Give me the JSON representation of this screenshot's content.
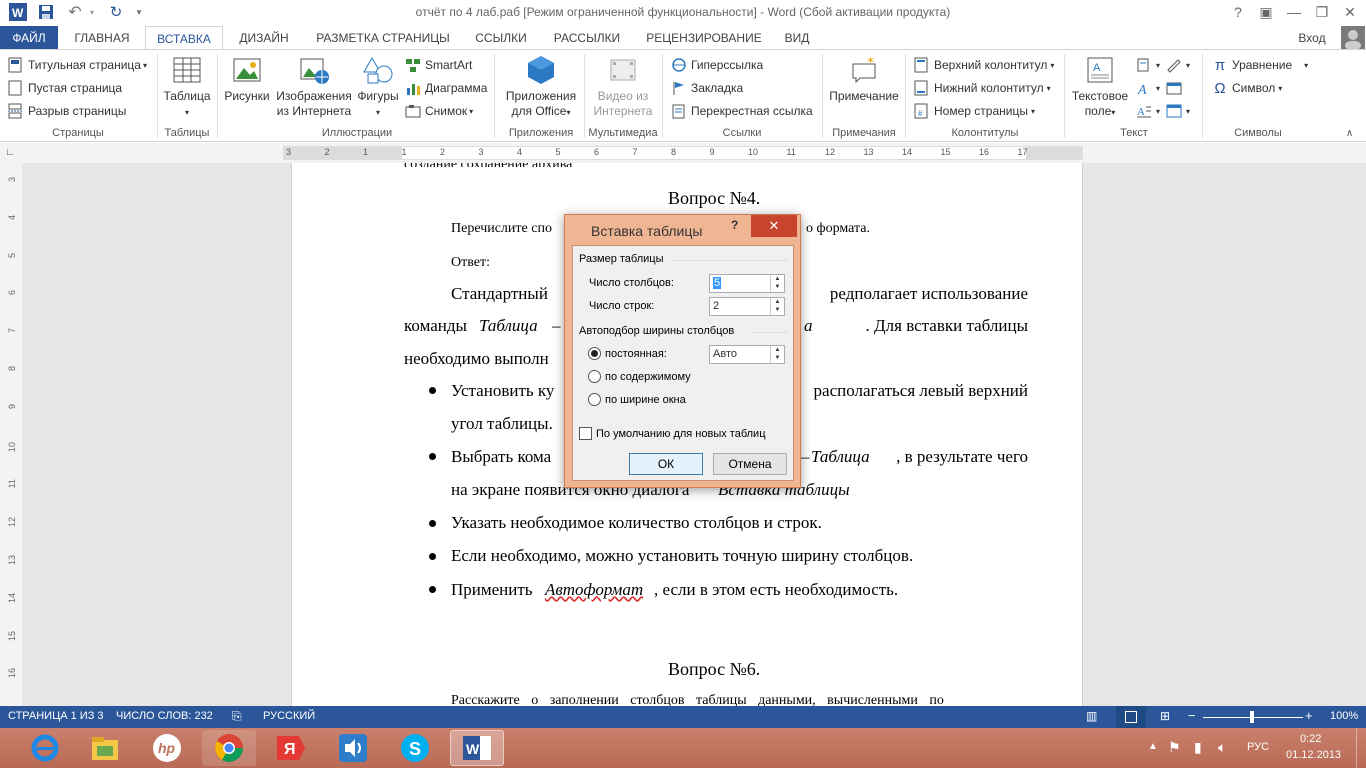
{
  "window": {
    "title": "отчёт по 4 лаб.раб [Режим ограниченной функциональности] - Word (Сбой активации продукта)",
    "help": "?",
    "user": "Вход"
  },
  "tabs": [
    "ФАЙЛ",
    "ГЛАВНАЯ",
    "ВСТАВКА",
    "ДИЗАЙН",
    "РАЗМЕТКА СТРАНИЦЫ",
    "ССЫЛКИ",
    "РАССЫЛКИ",
    "РЕЦЕНЗИРОВАНИЕ",
    "ВИД"
  ],
  "ribbon": {
    "pages": {
      "title_page": "Титульная страница",
      "blank_page": "Пустая страница",
      "page_break": "Разрыв страницы",
      "label": "Страницы"
    },
    "tables": {
      "table": "Таблица",
      "label": "Таблицы"
    },
    "illustrations": {
      "pictures": "Рисунки",
      "online1": "Изображения",
      "online2": "из Интернета",
      "shapes": "Фигуры",
      "smartart": "SmartArt",
      "chart": "Диаграмма",
      "screenshot": "Снимок",
      "label": "Иллюстрации"
    },
    "apps": {
      "apps1": "Приложения",
      "apps2": "для Office",
      "label": "Приложения"
    },
    "media": {
      "video1": "Видео из",
      "video2": "Интернета",
      "label": "Мультимедиа"
    },
    "links": {
      "hyperlink": "Гиперссылка",
      "bookmark": "Закладка",
      "crossref": "Перекрестная ссылка",
      "label": "Ссылки"
    },
    "comments": {
      "comment": "Примечание",
      "label": "Примечания"
    },
    "headerfooter": {
      "header": "Верхний колонтитул",
      "footer": "Нижний колонтитул",
      "pagenum": "Номер страницы",
      "label": "Колонтитулы"
    },
    "text": {
      "textbox1": "Текстовое",
      "textbox2": "поле",
      "label": "Текст"
    },
    "symbols": {
      "equation": "Уравнение",
      "symbol": "Символ",
      "label": "Символы"
    }
  },
  "ruler": {
    "ticks": [
      "3",
      "2",
      "1",
      "1",
      "2",
      "3",
      "4",
      "5",
      "6",
      "7",
      "8",
      "9",
      "10",
      "11",
      "12",
      "13",
      "14",
      "15",
      "16",
      "17"
    ],
    "vticks": [
      "3",
      "4",
      "5",
      "6",
      "7",
      "8",
      "9",
      "10",
      "11",
      "12",
      "13",
      "14",
      "15",
      "16"
    ]
  },
  "document": {
    "q4_title": "Вопрос №4.",
    "q4_text": "Перечислите спо",
    "q4_text_end": "о формата.",
    "answer": "Ответ:",
    "p1_start": "Стандартный",
    "p1_end": "редполагает использование",
    "p2_start": "команды",
    "p2_italic": "Таблица",
    "p2_end": ". Для вставки таблицы",
    "p2_a": "а",
    "p3": "необходимо выполн",
    "b1_start": "Установить ку",
    "b1_end": "располагаться левый верхний",
    "b1_cont": "угол таблицы.",
    "b2_start": "Выбрать кома",
    "b2_italic": "Таблица",
    "b2_end": ", в результате чего",
    "b2_cont": "на экране появится окно диалога",
    "b2_cont_italic": "Вставка таблицы",
    "b3": "Указать необходимое количество столбцов и строк.",
    "b4": "Если необходимо, можно установить точную ширину столбцов.",
    "b5_start": "Применить",
    "b5_italic": "Автоформат",
    "b5_end": ", если в этом есть необходимость.",
    "q6_title": "Вопрос №6.",
    "q6_text": "Расскажите о заполнении столбцов таблицы данными, вычисленными по"
  },
  "dialog": {
    "title": "Вставка таблицы",
    "help": "?",
    "size_group": "Размер таблицы",
    "cols_label": "Число столбцов:",
    "cols_value": "5",
    "rows_label": "Число строк:",
    "rows_value": "2",
    "autofit_group": "Автоподбор ширины столбцов",
    "fixed_label": "постоянная:",
    "fixed_value": "Авто",
    "content_label": "по содержимому",
    "window_label": "по ширине окна",
    "default_label": "По умолчанию для новых таблиц",
    "ok": "ОК",
    "cancel": "Отмена"
  },
  "status": {
    "page": "СТРАНИЦА 1 ИЗ 3",
    "words": "ЧИСЛО СЛОВ: 232",
    "lang": "РУССКИЙ",
    "zoom": "100%"
  },
  "taskbar": {
    "lang": "РУС",
    "time": "0:22",
    "date": "01.12.2013"
  },
  "colors": {
    "accent": "#2b579a",
    "taskbar": "#c07460",
    "dialog_frame": "#f0b693",
    "close": "#c7452d"
  }
}
